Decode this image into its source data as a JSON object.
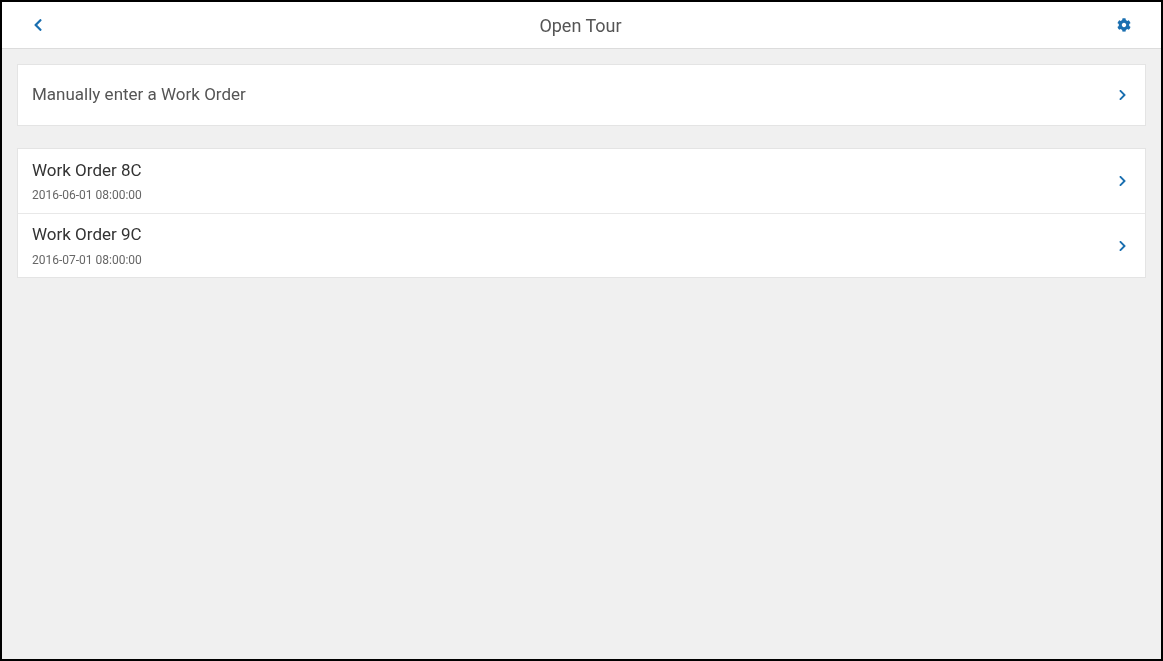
{
  "header": {
    "title": "Open Tour"
  },
  "manual_entry": {
    "label": "Manually enter a Work Order"
  },
  "work_orders": [
    {
      "title": "Work Order 8C",
      "date": "2016-06-01 08:00:00"
    },
    {
      "title": "Work Order 9C",
      "date": "2016-07-01 08:00:00"
    }
  ]
}
